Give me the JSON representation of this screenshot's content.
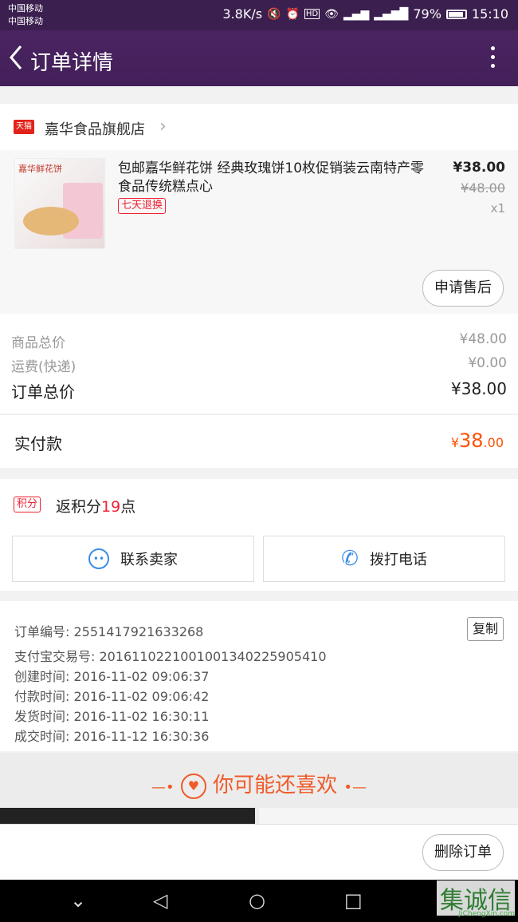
{
  "status_bar": {
    "carrier1": "中国移动",
    "carrier2": "中国移动",
    "speed": "3.8K/s",
    "battery": "79%",
    "time": "15:10",
    "icons": [
      "mute-icon",
      "alarm-icon",
      "hd-icon",
      "eye-icon",
      "4g-signal-icon",
      "2g-signal-icon",
      "battery-icon"
    ]
  },
  "nav": {
    "back_icon": "back-arrow-icon",
    "title": "订单详情",
    "more_icon": "more-vertical-icon"
  },
  "shop": {
    "badge": "天猫",
    "name": "嘉华食品旗舰店",
    "chevron": "›"
  },
  "item": {
    "thumb_logo": "嘉华鲜花饼",
    "title": "包邮嘉华鲜花饼 经典玫瑰饼10枚促销装云南特产零食品传统糕点心",
    "tag": "七天退换",
    "price": "¥38.00",
    "original_price": "¥48.00",
    "quantity": "x1",
    "aftersale_label": "申请售后"
  },
  "summary": {
    "goods_label": "商品总价",
    "goods_value": "¥48.00",
    "shipping_label": "运费(快递)",
    "shipping_value": "¥0.00",
    "total_label": "订单总价",
    "total_value": "¥38.00"
  },
  "paid": {
    "label": "实付款",
    "currency": "¥",
    "integer": "38",
    "decimal": ".00"
  },
  "points": {
    "badge": "积分",
    "prefix": "返积分",
    "amount": "19",
    "suffix": "点"
  },
  "actions": {
    "contact_label": "联系卖家",
    "call_label": "拨打电话"
  },
  "order_info": {
    "order_no": "订单编号: 2551417921633268",
    "copy_label": "复制",
    "alipay_no": "支付宝交易号: 2016110221001001340225905410",
    "created": "创建时间: 2016-11-02 09:06:37",
    "paid": "付款时间: 2016-11-02 09:06:42",
    "shipped": "发货时间: 2016-11-02 16:30:11",
    "completed": "成交时间: 2016-11-12 16:30:36"
  },
  "recommend": {
    "title": "你可能还喜欢"
  },
  "bottom": {
    "delete_label": "删除订单"
  },
  "watermark": {
    "main": "集诚信",
    "sub": "JiChengXin.com"
  },
  "colors": {
    "nav_bg": "#43205a",
    "accent": "#ff5000",
    "tag_red": "#e2231a",
    "link_blue": "#3a8ee6"
  }
}
